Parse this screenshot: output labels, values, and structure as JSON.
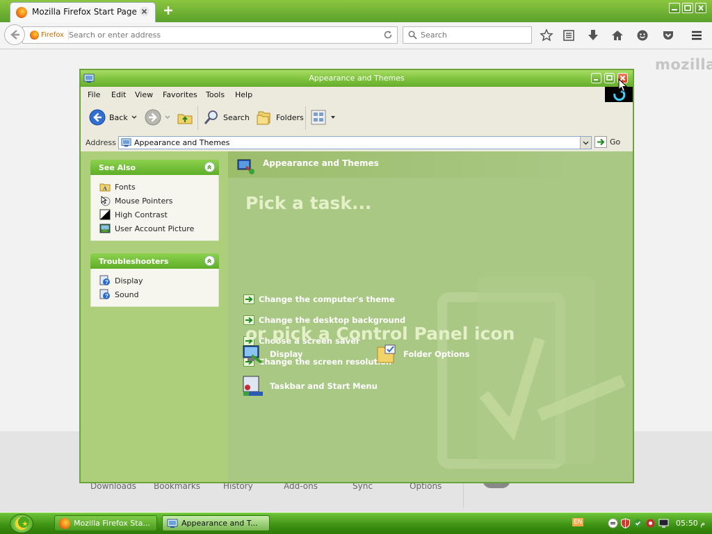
{
  "browser": {
    "tab_title": "Mozilla Firefox Start Page",
    "identity_label": "Firefox",
    "url_placeholder": "Search or enter address",
    "search_placeholder": "Search",
    "brand": "mozilla",
    "launchers": [
      "Downloads",
      "Bookmarks",
      "History",
      "Add-ons",
      "Sync",
      "Options"
    ]
  },
  "window": {
    "title": "Appearance and Themes",
    "menu": [
      "File",
      "Edit",
      "View",
      "Favorites",
      "Tools",
      "Help"
    ],
    "toolbar": {
      "back": "Back",
      "search": "Search",
      "folders": "Folders"
    },
    "address": {
      "label": "Address",
      "value": "Appearance and Themes",
      "go": "Go"
    }
  },
  "sidebar": {
    "see_also": {
      "title": "See Also",
      "items": [
        "Fonts",
        "Mouse Pointers",
        "High Contrast",
        "User Account Picture"
      ]
    },
    "troubleshooters": {
      "title": "Troubleshooters",
      "items": [
        "Display",
        "Sound"
      ]
    }
  },
  "main": {
    "header": "Appearance and Themes",
    "pick_task": "Pick a task...",
    "tasks": [
      "Change the computer's theme",
      "Change the desktop background",
      "Choose a screen saver",
      "Change the screen resolution"
    ],
    "pick_icon": "or pick a Control Panel icon",
    "icons": [
      "Display",
      "Folder Options",
      "Taskbar and Start Menu"
    ]
  },
  "taskbar": {
    "buttons": [
      "Mozilla Firefox Sta...",
      "Appearance and T..."
    ],
    "language": "EN",
    "clock": "05:50 م"
  },
  "colors": {
    "xp_green": "#7cc23c",
    "main_bg": "#a9c884",
    "sidebar_bg": "#adce7a"
  }
}
